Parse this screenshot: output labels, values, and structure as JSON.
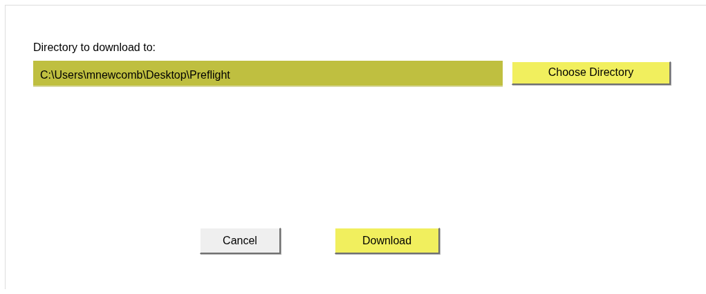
{
  "directory": {
    "label": "Directory to download to:",
    "value": "C:\\Users\\mnewcomb\\Desktop\\Preflight",
    "button": {
      "label": "Choose Directory",
      "highlighted": true
    }
  },
  "buttons": [
    {
      "label": "Cancel",
      "highlighted": false
    },
    {
      "label": "Download",
      "highlighted": true
    }
  ]
}
